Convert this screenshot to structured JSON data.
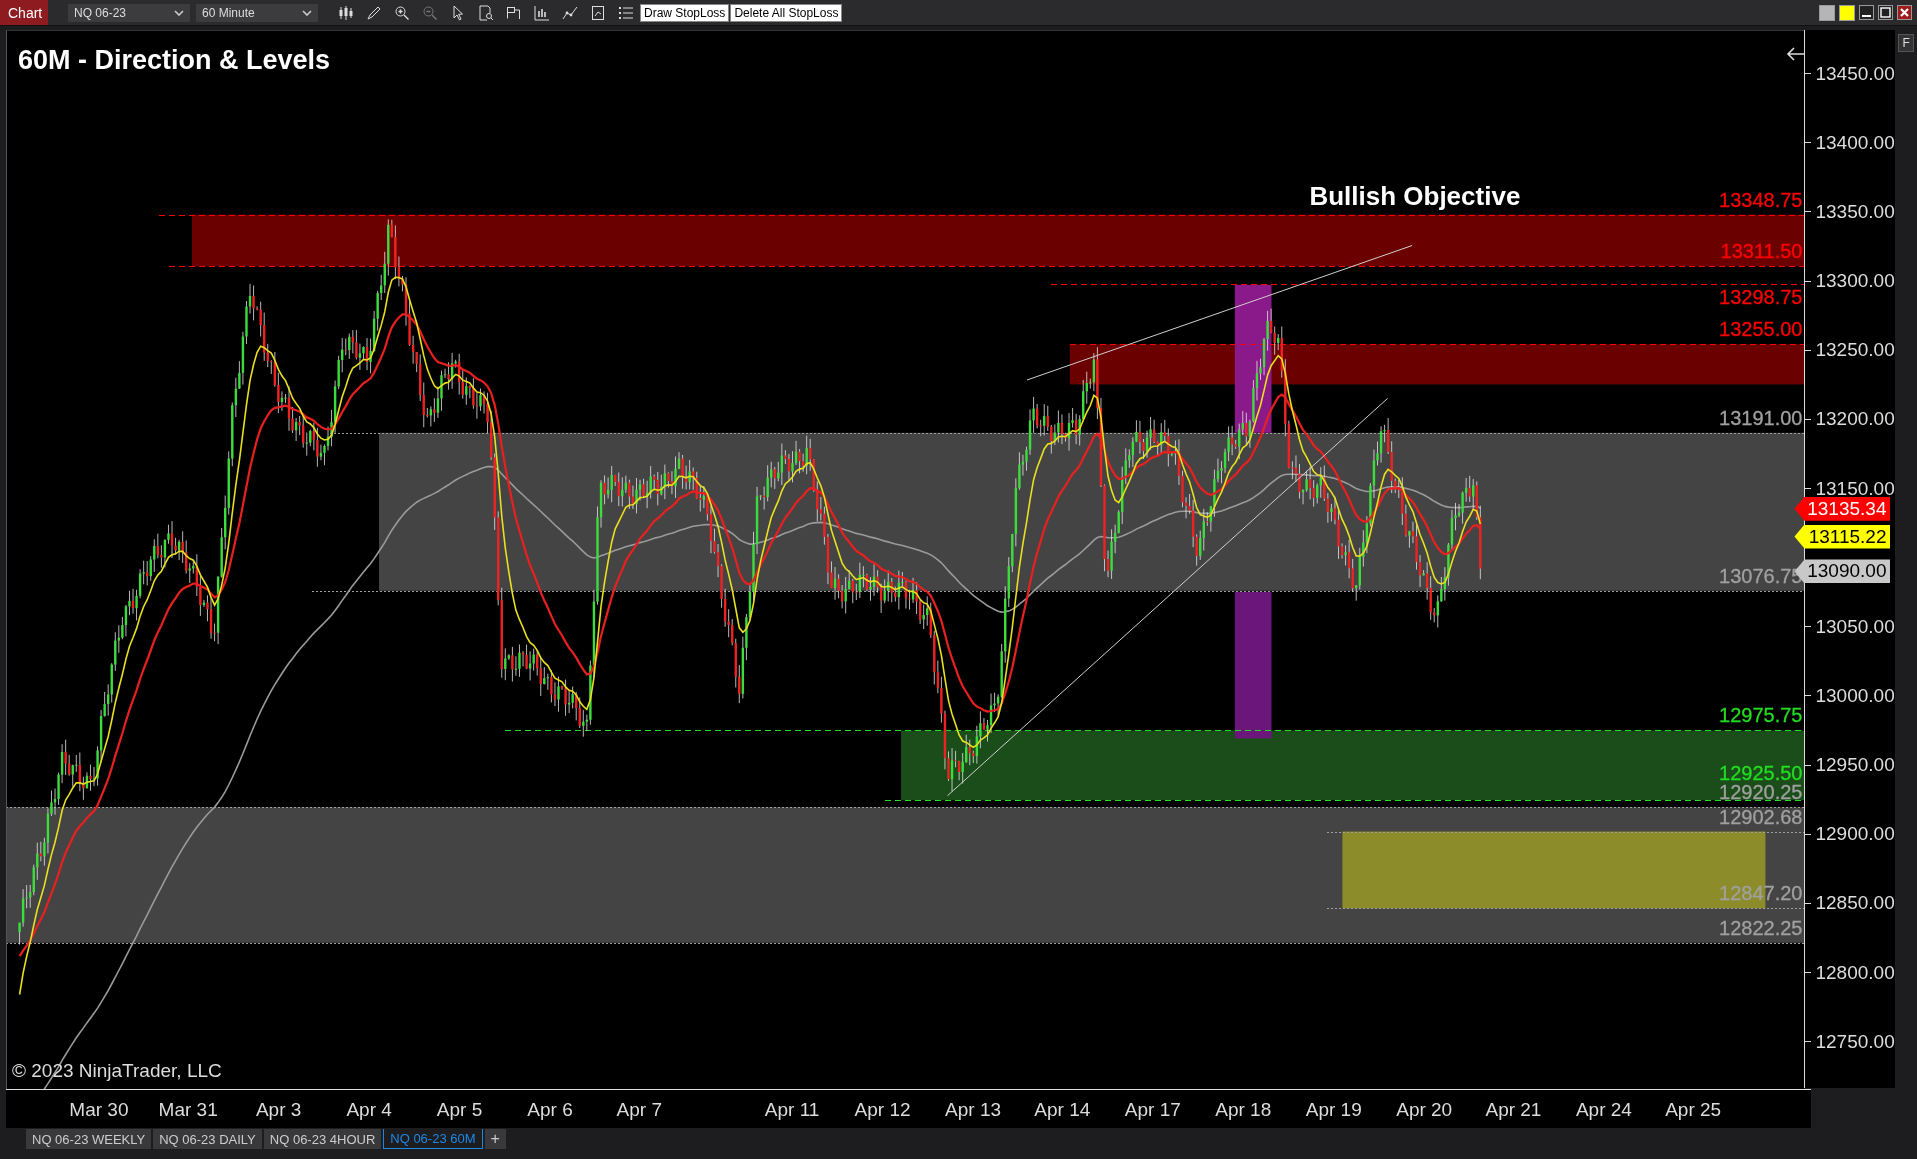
{
  "toolbar": {
    "chart_button": "Chart",
    "instrument": "NQ 06-23",
    "interval": "60 Minute",
    "buttons": [
      "Draw StopLoss",
      "Delete All StopLoss"
    ]
  },
  "chart": {
    "title": "60M - Direction & Levels",
    "annotation": "Bullish Objective",
    "copyright": "© 2023 NinjaTrader, LLC",
    "side_button": "F",
    "price_axis": [
      "13450.00",
      "13400.00",
      "13350.00",
      "13300.00",
      "13250.00",
      "13200.00",
      "13150.00",
      "13050.00",
      "13000.00",
      "12950.00",
      "12900.00",
      "12850.00",
      "12800.00",
      "12750.00"
    ],
    "levels": [
      {
        "label": "13348.75",
        "color": "#ff0000"
      },
      {
        "label": "13311.50",
        "color": "#ff0000"
      },
      {
        "label": "13298.75",
        "color": "#ff0000"
      },
      {
        "label": "13255.00",
        "color": "#ff0000"
      },
      {
        "label": "13191.00",
        "color": "#a0a0a0"
      },
      {
        "label": "13076.75",
        "color": "#a0a0a0"
      },
      {
        "label": "12975.75",
        "color": "#22dd22"
      },
      {
        "label": "12925.50",
        "color": "#22dd22"
      },
      {
        "label": "12920.25",
        "color": "#a0a0a0"
      },
      {
        "label": "12902.68",
        "color": "#a0a0a0"
      },
      {
        "label": "12847.20",
        "color": "#a0a0a0"
      },
      {
        "label": "12822.25",
        "color": "#a0a0a0"
      }
    ],
    "price_tags": [
      {
        "label": "13135.34",
        "color": "#ff0000"
      },
      {
        "label": "13115.22",
        "color": "#ffff00"
      },
      {
        "label": "13090.00",
        "color": "#c8c8c8"
      }
    ],
    "dates": [
      "Mar 30",
      "Mar 31",
      "Apr 3",
      "Apr 4",
      "Apr 5",
      "Apr 6",
      "Apr 7",
      "Apr 11",
      "Apr 12",
      "Apr 13",
      "Apr 14",
      "Apr 17",
      "Apr 18",
      "Apr 19",
      "Apr 20",
      "Apr 21",
      "Apr 24",
      "Apr 25"
    ]
  },
  "tabs": [
    {
      "label": "NQ 06-23 WEEKLY",
      "selected": false
    },
    {
      "label": "NQ 06-23 DAILY",
      "selected": false
    },
    {
      "label": "NQ 06-23 4HOUR",
      "selected": false
    },
    {
      "label": "NQ 06-23 60M",
      "selected": true
    }
  ],
  "new_tab": "+"
}
